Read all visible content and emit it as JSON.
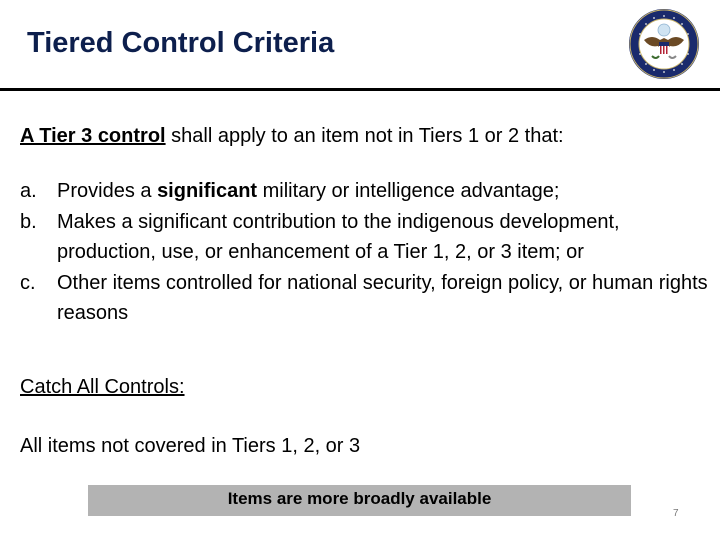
{
  "slide": {
    "title": "Tiered Control Criteria",
    "seal_icon": "department-of-state-seal",
    "intro": {
      "lead": "A Tier 3 control",
      "rest": " shall apply to an item not in Tiers 1 or 2 that:"
    },
    "criteria": [
      {
        "marker": "a.",
        "pre": "Provides a ",
        "bold": "significant",
        "post": " military or intelligence advantage;"
      },
      {
        "marker": "b.",
        "pre": "Makes a significant contribution to the indigenous development, production, use, or enhancement of a Tier 1, 2, or 3 item; or",
        "bold": "",
        "post": ""
      },
      {
        "marker": "c.",
        "pre": "Other items controlled for national security, foreign policy, or human rights reasons",
        "bold": "",
        "post": ""
      }
    ],
    "catch_all_heading": "Catch All Controls:",
    "catch_all_text": "All items not covered in Tiers 1, 2, or 3",
    "banner": "Items are more broadly available",
    "page_number": "7",
    "colors": {
      "title": "#0d1f4d",
      "banner_bg": "#b3b3b3",
      "seal_blue": "#1a2a6c"
    }
  }
}
